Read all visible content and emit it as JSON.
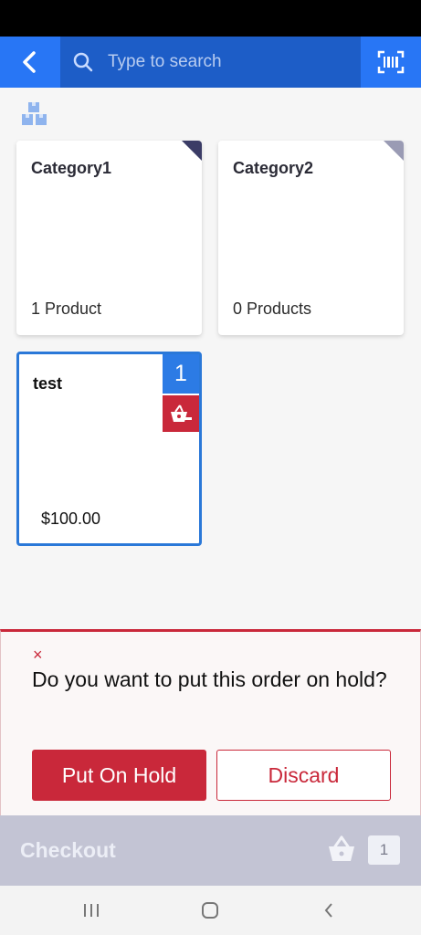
{
  "search": {
    "placeholder": "Type to search"
  },
  "categories": [
    {
      "title": "Category1",
      "count_label": "1 Product"
    },
    {
      "title": "Category2",
      "count_label": "0 Products"
    }
  ],
  "product": {
    "title": "test",
    "price": "$100.00",
    "quantity": "1"
  },
  "hold_dialog": {
    "close": "×",
    "question": "Do you want to put this order on hold?",
    "hold_label": "Put On Hold",
    "discard_label": "Discard"
  },
  "checkout": {
    "label": "Checkout",
    "cart_count": "1"
  },
  "icons": {
    "back": "chevron-left-icon",
    "search": "search-icon",
    "scan": "barcode-scan-icon",
    "home": "boxes-icon",
    "remove": "basket-remove-icon",
    "basket": "basket-icon"
  },
  "colors": {
    "primary_blue": "#2876f5",
    "danger_red": "#c9283a",
    "checkout_bg": "#c3c4d4"
  }
}
